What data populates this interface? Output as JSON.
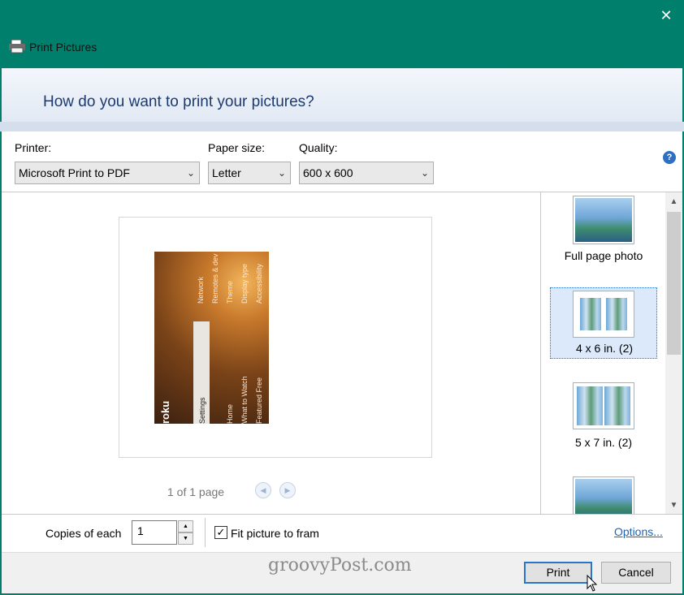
{
  "window": {
    "title": "Print Pictures",
    "close_glyph": "✕"
  },
  "header": {
    "question": "How do you want to print your pictures?"
  },
  "settings": {
    "printer_label": "Printer:",
    "printer_value": "Microsoft Print to PDF",
    "paper_size_label": "Paper size:",
    "paper_size_value": "Letter",
    "quality_label": "Quality:",
    "quality_value": "600 x 600",
    "help_glyph": "?"
  },
  "preview": {
    "page_count": "1 of 1 page",
    "photo_texts": {
      "network": "Network",
      "remotes": "Remotes & dev",
      "theme": "Theme",
      "display_type": "Display type",
      "accessibility": "Accessibility",
      "settings": "Settings",
      "home": "Home",
      "what_to_watch": "What to Watch",
      "featured_free": "Featured Free",
      "brand": "roku"
    }
  },
  "layouts": [
    {
      "label": "Full page photo",
      "selected": false
    },
    {
      "label": "4 x 6 in. (2)",
      "selected": true
    },
    {
      "label": "5 x 7 in. (2)",
      "selected": false
    }
  ],
  "options": {
    "copies_label": "Copies of each",
    "copies_value": "1",
    "fit_label": "Fit picture to fram",
    "fit_checked": true,
    "options_link": "Options..."
  },
  "footer": {
    "watermark": "groovyPost.com",
    "print_button": "Print",
    "cancel_button": "Cancel"
  },
  "colors": {
    "titlebar": "#00806c",
    "header_text": "#1c3a6e",
    "link": "#1d63b8",
    "selection": "#dbe9fb"
  }
}
